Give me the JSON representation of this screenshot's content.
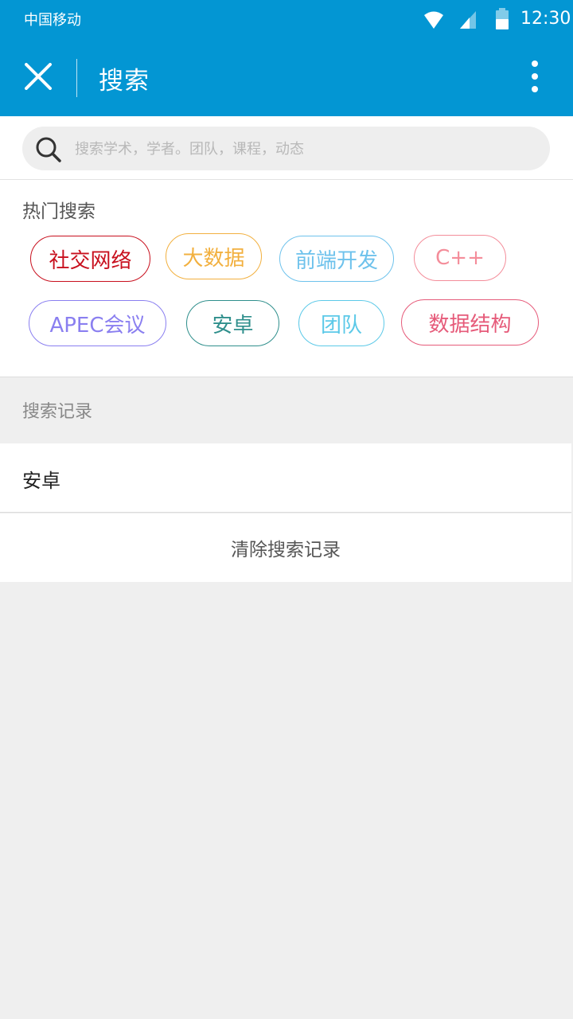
{
  "status_bar": {
    "carrier": "中国移动",
    "time": "12:30",
    "icons": [
      "wifi-icon",
      "cell-signal-icon",
      "battery-icon"
    ]
  },
  "toolbar": {
    "close_icon": "close-icon",
    "title": "搜索",
    "more_icon": "more-vertical-icon",
    "background_color": "#0396d3"
  },
  "search": {
    "icon": "search-icon",
    "value": "",
    "placeholder": "搜索学术，学者。团队，课程，动态"
  },
  "hot": {
    "title": "热门搜索",
    "tags": [
      {
        "label": "社交网络",
        "color": "#c8101e"
      },
      {
        "label": "大数据",
        "color": "#f2b03f"
      },
      {
        "label": "前端开发",
        "color": "#6ec2ec"
      },
      {
        "label": "C++",
        "color": "#f48d9a"
      },
      {
        "label": "APEC会议",
        "color": "#8a7ff0"
      },
      {
        "label": "安卓",
        "color": "#2f8f8c"
      },
      {
        "label": "团队",
        "color": "#5cc9e8"
      },
      {
        "label": "数据结构",
        "color": "#e65b7a"
      }
    ]
  },
  "history": {
    "title": "搜索记录",
    "items": [
      "安卓"
    ],
    "clear_label": "清除搜索记录"
  }
}
